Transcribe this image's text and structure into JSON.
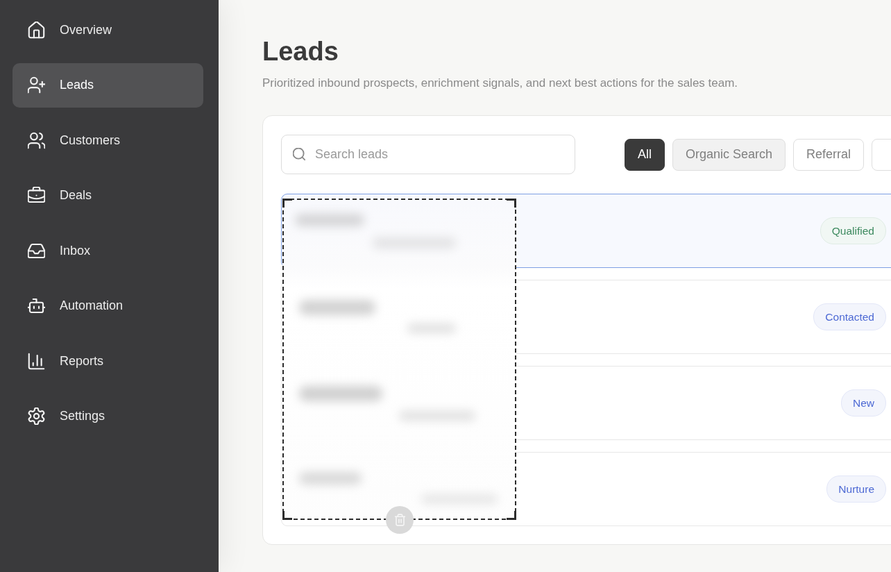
{
  "sidebar": {
    "items": [
      {
        "label": "Overview",
        "selected": false
      },
      {
        "label": "Leads",
        "selected": true
      },
      {
        "label": "Customers",
        "selected": false
      },
      {
        "label": "Deals",
        "selected": false
      },
      {
        "label": "Inbox",
        "selected": false
      },
      {
        "label": "Automation",
        "selected": false
      },
      {
        "label": "Reports",
        "selected": false
      },
      {
        "label": "Settings",
        "selected": false
      }
    ]
  },
  "page": {
    "title": "Leads",
    "subtitle": "Prioritized inbound prospects, enrichment signals, and next best actions for the sales team."
  },
  "search": {
    "placeholder": "Search leads"
  },
  "filters": [
    {
      "label": "All",
      "selected": true
    },
    {
      "label": "Organic Search",
      "selected": false
    },
    {
      "label": "Referral",
      "selected": false
    },
    {
      "selected": false
    }
  ],
  "leads": [
    {
      "selected": true,
      "status": "Qualified",
      "color": "#3d8a5f"
    },
    {
      "selected": false,
      "status": "Contacted",
      "color": "#4d69d4"
    },
    {
      "selected": false,
      "status": "New",
      "color": "#4d69d4"
    },
    {
      "selected": false,
      "status": "Nurture",
      "color": "#4d69d4"
    }
  ]
}
